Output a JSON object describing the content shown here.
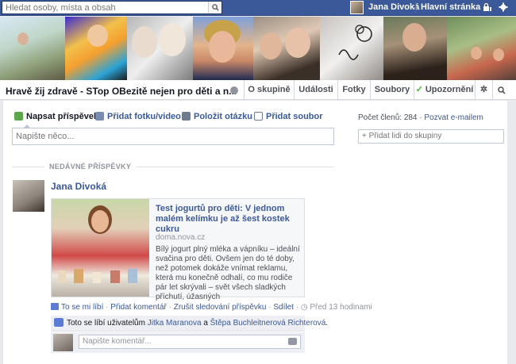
{
  "topbar": {
    "search_placeholder": "Hledat osoby, místa a obsah",
    "user_name": "Jana Divoká",
    "home_label": "Hlavní stránka",
    "icons": [
      "search-icon",
      "friends-lock-icon",
      "settings-gear-icon"
    ]
  },
  "group": {
    "title": "Hravě žij zdravě - STop OBezitě nejen pro děti a n...",
    "privacy_icon": "globe-icon",
    "tabs": [
      {
        "label": "O skupině"
      },
      {
        "label": "Události"
      },
      {
        "label": "Fotky"
      },
      {
        "label": "Soubory"
      },
      {
        "label": "Upozornění",
        "checked": true
      }
    ],
    "tab_icons": [
      "gear-icon",
      "search-icon"
    ]
  },
  "composer": {
    "actions": [
      "Napsat příspěvek",
      "Přidat fotku/video",
      "Položit otázku",
      "Přidat soubor"
    ],
    "placeholder": "Napište něco..."
  },
  "sidebar": {
    "members_label": "Počet členů: 284",
    "separator": "·",
    "invite_label": "Pozvat e-mailem",
    "add_people_label": "+ Přidat lidi do skupiny"
  },
  "feed": {
    "section_label": "NEDÁVNÉ PŘÍSPĚVKY",
    "post": {
      "author": "Jana Divoká",
      "attachment": {
        "title": "Test jogurtů pro děti: V jednom malém kelímku je až šest kostek cukru",
        "domain": "doma.nova.cz",
        "description": "Bílý jogurt plný mléka a vápníku – ideální svačina pro děti. Ovšem jen do té doby, než potomek dokáže vnímat reklamu, která mu konečně odhalí, co mu rodiče pár let skrývali – svět všech sladkých příchutí, úžasných"
      },
      "actions": [
        "To se mi líbí",
        "Přidat komentář",
        "Zrušit sledování příspěvku",
        "Sdílet"
      ],
      "time": "Před 13 hodinami",
      "likes_prefix": "Toto se líbí uživatelům",
      "likers": [
        "Jitka Maranova",
        "Štěpa Buchleitnerová Richterová"
      ],
      "likes_join": "a",
      "comment_placeholder": "Napište komentář..."
    }
  },
  "colors": {
    "topbar": "#3b5998",
    "link": "#3b5998",
    "background": "#e9eaed"
  }
}
